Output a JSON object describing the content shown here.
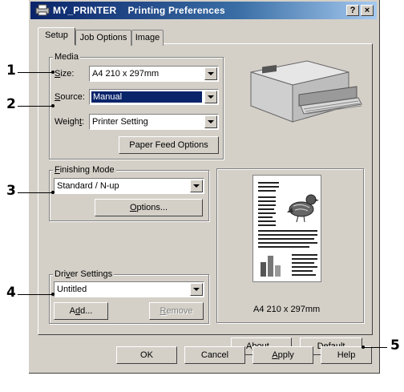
{
  "window": {
    "title": "MY_PRINTER    Printing Preferences",
    "help_btn": "?",
    "close_btn": "×"
  },
  "tabs": [
    {
      "label": "Setup",
      "active": true
    },
    {
      "label": "Job Options",
      "active": false
    },
    {
      "label": "Image",
      "active": false
    }
  ],
  "media": {
    "group_label": "Media",
    "size_label": "Size:",
    "size_value": "A4 210 x 297mm",
    "source_label": "Source:",
    "source_value": "Manual",
    "weight_label": "Weight:",
    "weight_value": "Printer Setting",
    "paper_feed_button": "Paper Feed Options"
  },
  "finishing": {
    "group_label": "Finishing Mode",
    "mode_value": "Standard / N-up",
    "options_button": "Options..."
  },
  "driver": {
    "group_label": "Driver Settings",
    "value": "Untitled",
    "add_button": "Add...",
    "remove_button": "Remove"
  },
  "preview": {
    "caption": "A4 210 x 297mm"
  },
  "buttons": {
    "about": "About...",
    "default": "Default",
    "ok": "OK",
    "cancel": "Cancel",
    "apply": "Apply",
    "help": "Help"
  },
  "callouts": [
    "1",
    "2",
    "3",
    "4",
    "5"
  ],
  "colors": {
    "dialog_bg": "#d4d0c8",
    "title_bar": "#0a246a",
    "selection": "#0a246a"
  }
}
